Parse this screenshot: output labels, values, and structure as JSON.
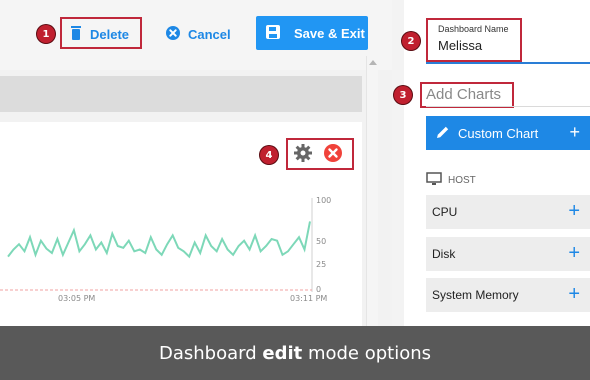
{
  "toolbar": {
    "delete_label": "Delete",
    "cancel_label": "Cancel",
    "save_label": "Save & Exit"
  },
  "badges": [
    "1",
    "2",
    "3",
    "4"
  ],
  "chart": {
    "y_ticks": [
      "100",
      "50",
      "25",
      "0"
    ],
    "x_ticks": [
      "03:05 PM",
      "03:11 PM"
    ],
    "series_color": "#7dd8b8",
    "baseline_color": "#f0a0a0",
    "y_values": [
      38,
      46,
      52,
      44,
      60,
      40,
      56,
      47,
      42,
      58,
      40,
      54,
      68,
      44,
      52,
      62,
      46,
      54,
      42,
      64,
      50,
      48,
      56,
      44,
      46,
      42,
      60,
      46,
      40,
      52,
      62,
      48,
      44,
      38,
      54,
      42,
      62,
      50,
      44,
      58,
      46,
      40,
      50,
      56,
      46,
      62,
      44,
      50,
      58,
      56,
      40,
      44,
      52,
      60,
      46,
      78
    ]
  },
  "right_panel": {
    "dashboard_name_label": "Dashboard Name",
    "dashboard_name_value": "Melissa",
    "add_charts_label": "Add Charts",
    "custom_chart_label": "Custom Chart",
    "host_label": "HOST",
    "items": [
      "CPU",
      "Disk",
      "System Memory"
    ]
  },
  "colors": {
    "accent": "#1e88e5",
    "highlight": "#c0283b"
  },
  "caption": {
    "prefix": "Dashboard ",
    "bold": "edit",
    "suffix": " mode options"
  }
}
